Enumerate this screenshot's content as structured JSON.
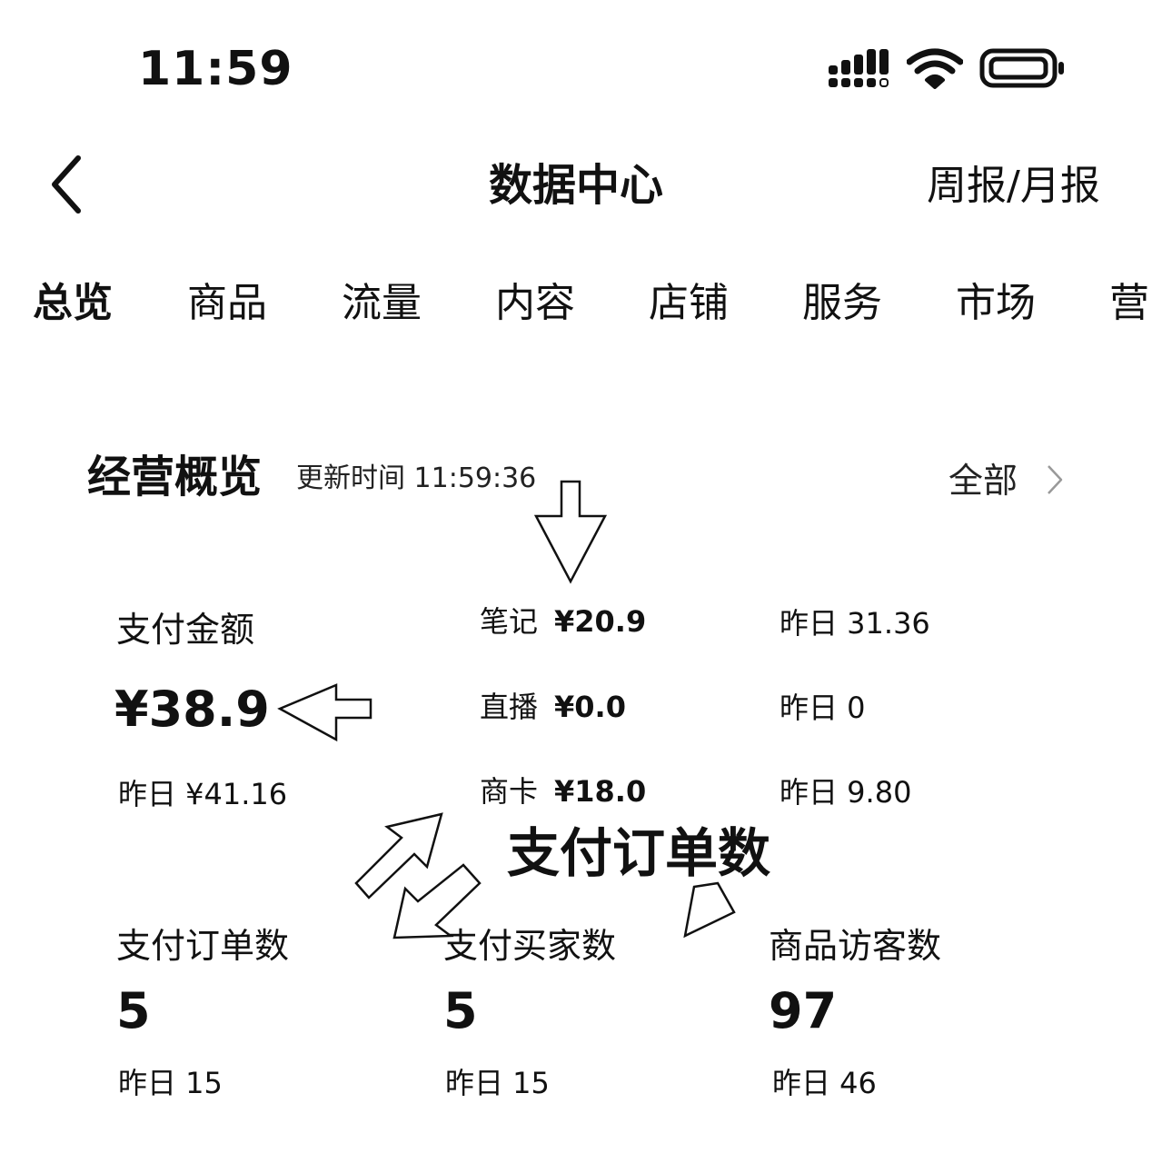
{
  "status_bar": {
    "time": "11:59",
    "signal_icon": "cellular-signal-icon",
    "wifi_icon": "wifi-icon",
    "battery_icon": "battery-icon"
  },
  "header": {
    "back_icon": "chevron-left-icon",
    "title": "数据中心",
    "report_link": "周报/月报"
  },
  "tabs": [
    {
      "label": "总览",
      "active": true
    },
    {
      "label": "商品",
      "active": false
    },
    {
      "label": "流量",
      "active": false
    },
    {
      "label": "内容",
      "active": false
    },
    {
      "label": "店铺",
      "active": false
    },
    {
      "label": "服务",
      "active": false
    },
    {
      "label": "市场",
      "active": false
    },
    {
      "label": "营",
      "active": false
    }
  ],
  "overview": {
    "title": "经营概览",
    "update_time": "更新时间 11:59:36",
    "all_link": "全部",
    "all_icon": "chevron-right-icon",
    "payment": {
      "label": "支付金额",
      "value": "¥38.9",
      "yesterday": "昨日 ¥41.16"
    },
    "channels": [
      {
        "name": "笔记",
        "value": "¥20.9",
        "yesterday": "昨日 31.36"
      },
      {
        "name": "直播",
        "value": "¥0.0",
        "yesterday": "昨日 0"
      },
      {
        "name": "商卡",
        "value": "¥18.0",
        "yesterday": "昨日 9.80"
      }
    ],
    "metrics": [
      {
        "label": "支付订单数",
        "value": "5",
        "yesterday": "昨日 15"
      },
      {
        "label": "支付买家数",
        "value": "5",
        "yesterday": "昨日 15"
      },
      {
        "label": "商品访客数",
        "value": "97",
        "yesterday": "昨日 46"
      }
    ]
  },
  "annotation": {
    "text": "支付订单数",
    "arrow_icon": "outline-arrow-icon"
  }
}
